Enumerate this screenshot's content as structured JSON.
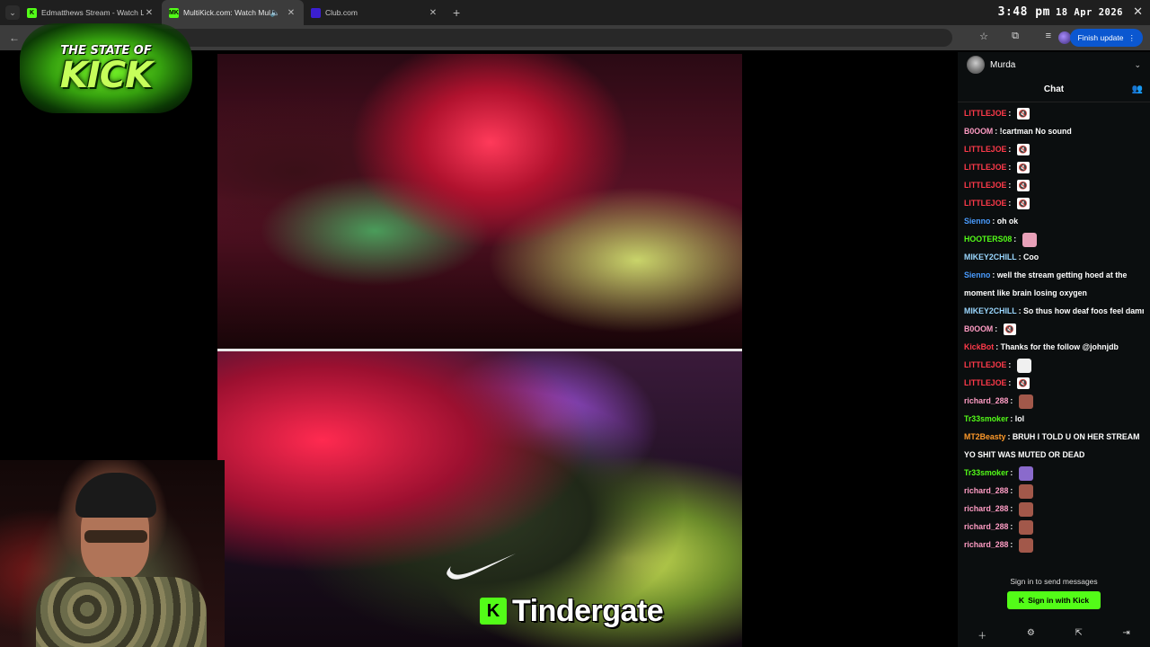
{
  "browser": {
    "tabs": [
      {
        "title": "Edmatthews Stream - Watch Li",
        "favicon_color": "#53fc18",
        "favicon_letter": "K"
      },
      {
        "title": "MultiKick.com: Watch Multi",
        "favicon_color": "#53fc18",
        "favicon_letter": "MK"
      },
      {
        "title": "Club.com",
        "favicon_color": "#3b1fd1",
        "favicon_letter": ""
      }
    ],
    "new_tab": "+",
    "clock_time": "3:48 pm",
    "clock_date": "18 Apr 2026",
    "finish_update": "Finish update"
  },
  "logo": {
    "top": "THE STATE OF",
    "main": "KICK"
  },
  "overlay": {
    "k_icon": "K",
    "text": "Tindergate"
  },
  "chat": {
    "channel_name": "Murda",
    "title": "Chat",
    "messages": [
      {
        "user": "LITTLEJOE",
        "color": "#ff3a4a",
        "text": "",
        "emote": "mute"
      },
      {
        "user": "B0OOM",
        "color": "#ff9cc4",
        "text": "!cartman No sound",
        "emote": ""
      },
      {
        "user": "LITTLEJOE",
        "color": "#ff3a4a",
        "text": "",
        "emote": "mute"
      },
      {
        "user": "LITTLEJOE",
        "color": "#ff3a4a",
        "text": "",
        "emote": "mute"
      },
      {
        "user": "LITTLEJOE",
        "color": "#ff3a4a",
        "text": "",
        "emote": "mute"
      },
      {
        "user": "LITTLEJOE",
        "color": "#ff3a4a",
        "text": "",
        "emote": "mute"
      },
      {
        "user": "Sienno",
        "color": "#4a9cff",
        "text": "oh ok",
        "emote": ""
      },
      {
        "user": "HOOTERS08",
        "color": "#53fc18",
        "text": "",
        "emote": "face-pink"
      },
      {
        "user": "MIKEY2CHILL",
        "color": "#9ad7ff",
        "text": "Coo",
        "emote": ""
      },
      {
        "user": "Sienno",
        "color": "#4a9cff",
        "text": "well the stream getting hoed at the moment like brain losing oxygen",
        "emote": ""
      },
      {
        "user": "MIKEY2CHILL",
        "color": "#9ad7ff",
        "text": "So thus how deaf foos feel damn",
        "emote": ""
      },
      {
        "user": "B0OOM",
        "color": "#ff9cc4",
        "text": "",
        "emote": "mute"
      },
      {
        "user": "KickBot",
        "color": "#ff3a4a",
        "text": "Thanks for the follow @johnjdb",
        "emote": ""
      },
      {
        "user": "LITTLEJOE",
        "color": "#ff3a4a",
        "text": "",
        "emote": "skull"
      },
      {
        "user": "LITTLEJOE",
        "color": "#ff3a4a",
        "text": "",
        "emote": "mute"
      },
      {
        "user": "richard_288",
        "color": "#ff9cc4",
        "text": "",
        "emote": "face-brown"
      },
      {
        "user": "Tr33smoker",
        "color": "#53fc18",
        "text": "lol",
        "emote": ""
      },
      {
        "user": "MT2Beasty",
        "color": "#ff9a2a",
        "text": "BRUH I TOLD U ON HER STREAM YO SHIT WAS MUTED OR DEAD",
        "emote": ""
      },
      {
        "user": "Tr33smoker",
        "color": "#53fc18",
        "text": "",
        "emote": "face-purple"
      },
      {
        "user": "richard_288",
        "color": "#ff9cc4",
        "text": "",
        "emote": "face-brown"
      },
      {
        "user": "richard_288",
        "color": "#ff9cc4",
        "text": "",
        "emote": "face-brown"
      },
      {
        "user": "richard_288",
        "color": "#ff9cc4",
        "text": "",
        "emote": "face-brown"
      },
      {
        "user": "richard_288",
        "color": "#ff9cc4",
        "text": "",
        "emote": "face-brown"
      }
    ],
    "signin_prompt": "Sign in to send messages",
    "signin_button": "Sign in with Kick",
    "accent": "#53fc18"
  }
}
